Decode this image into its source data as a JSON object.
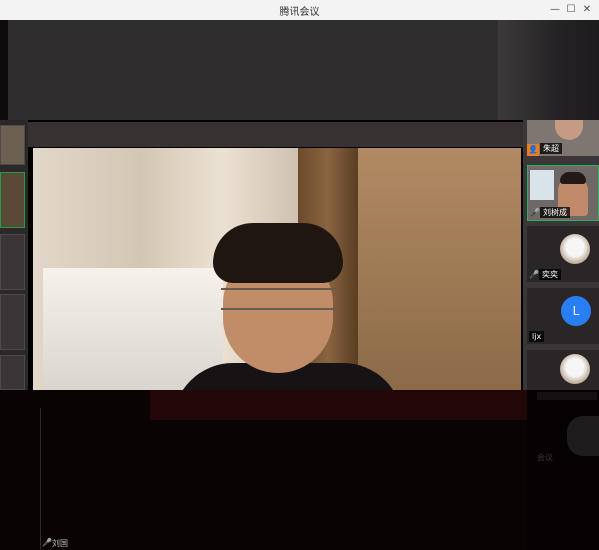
{
  "window": {
    "title": "腾讯会议",
    "controls": {
      "minimize": "—",
      "maximize": "☐",
      "close": "✕"
    }
  },
  "main_view": {
    "active_speaker_name": "刘国",
    "active_speaker_mic": "🎤"
  },
  "participants": [
    {
      "name": "朱超",
      "mic": "🎤",
      "badge": "👤",
      "avatar": "video"
    },
    {
      "name": "刘树成",
      "mic": "🎤",
      "avatar": "video",
      "active": true
    },
    {
      "name": "奕奕",
      "mic": "🎤",
      "avatar": "cat-image"
    },
    {
      "name": "ljx",
      "mic": "",
      "avatar": "initial",
      "initial": "L"
    },
    {
      "name": "",
      "mic": "",
      "avatar": "cat-image"
    }
  ],
  "right_lower": {
    "text": "会议"
  },
  "colors": {
    "active_border": "#2fb05b",
    "avatar_blue": "#2a7ef4",
    "host_badge": "#f07b20"
  }
}
